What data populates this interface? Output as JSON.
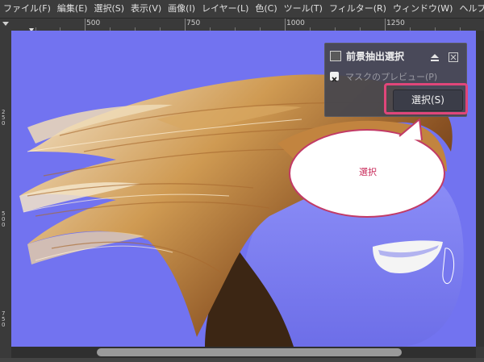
{
  "menubar": {
    "items": [
      "ファイル(F)",
      "編集(E)",
      "選択(S)",
      "表示(V)",
      "画像(I)",
      "レイヤー(L)",
      "色(C)",
      "ツール(T)",
      "フィルター(R)",
      "ウィンドウ(W)",
      "ヘルプ(H)"
    ]
  },
  "ruler": {
    "top_labels": [
      "500",
      "750",
      "1000",
      "1250"
    ],
    "left_labels": [
      "250",
      "500",
      "750"
    ]
  },
  "tool_dialog": {
    "title": "前景抽出選択",
    "checkbox_label": "マスクのプレビュー(P)",
    "select_button": "選択(S)"
  },
  "callout": {
    "text": "選択"
  },
  "colors": {
    "canvas_mask": "#7273f0",
    "highlight": "#e0467a",
    "callout_text": "#c82a5a"
  }
}
